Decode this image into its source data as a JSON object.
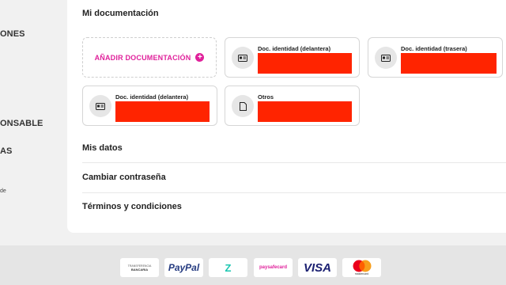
{
  "sidebar": {
    "items": [
      "ONES",
      "ONSABLE",
      "AS"
    ],
    "small_text": "de"
  },
  "documentation": {
    "title": "Mi documentación",
    "add_label": "AÑADIR DOCUMENTACIÓN",
    "docs": [
      {
        "label": "Doc. identidad (delantera)",
        "icon": "id-card-icon"
      },
      {
        "label": "Doc. identidad (trasera)",
        "icon": "id-card-icon"
      },
      {
        "label": "Doc. identidad (delantera)",
        "icon": "id-card-icon"
      },
      {
        "label": "Otros",
        "icon": "file-icon"
      }
    ],
    "redaction_color": "#ff2400"
  },
  "menu": {
    "mis_datos": "Mis datos",
    "cambiar": "Cambiar contraseña",
    "terminos": "Términos y condiciones"
  },
  "payments": {
    "transfer_line1": "TRANSFERENCIA",
    "transfer_line2": "BANCARIA",
    "paypal": "PayPal",
    "skrill": "Z",
    "paysafe": "paysafecard",
    "visa": "VISA",
    "mastercard": "mastercard"
  },
  "colors": {
    "accent": "#e0219b",
    "paypal_dark": "#253b80",
    "paypal_light": "#179bd7",
    "visa": "#1a1f71"
  }
}
